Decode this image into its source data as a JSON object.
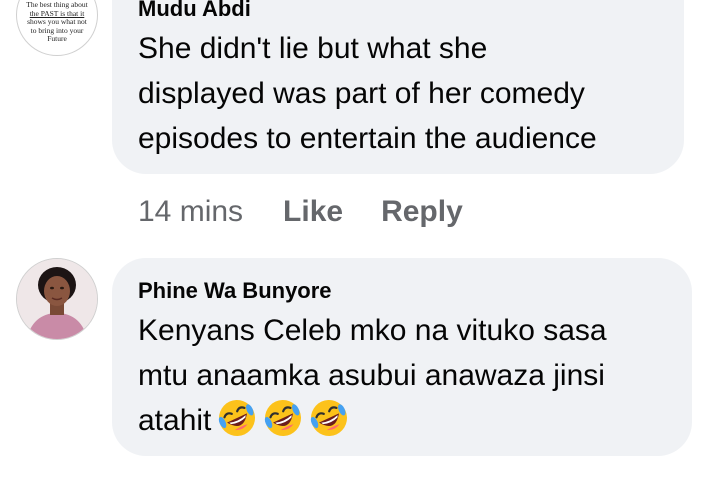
{
  "comments": [
    {
      "author": "Mudu Abdi",
      "avatar_text": [
        "The best thing about",
        "the PAST is that it",
        "shows you what not",
        "to bring into your",
        "Future"
      ],
      "lines": [
        "She didn't lie but what she",
        "displayed was part of her comedy",
        "episodes to entertain the audience"
      ],
      "time": "14 mins",
      "like_label": "Like",
      "reply_label": "Reply"
    },
    {
      "author": "Phine Wa Bunyore",
      "lines": [
        "Kenyans Celeb mko na vituko sasa",
        "mtu anaamka asubui anawaza jinsi",
        "atahit"
      ],
      "emojis": [
        "rolling-on-floor-laughing-emoji",
        "rolling-on-floor-laughing-emoji",
        "rolling-on-floor-laughing-emoji"
      ]
    }
  ]
}
